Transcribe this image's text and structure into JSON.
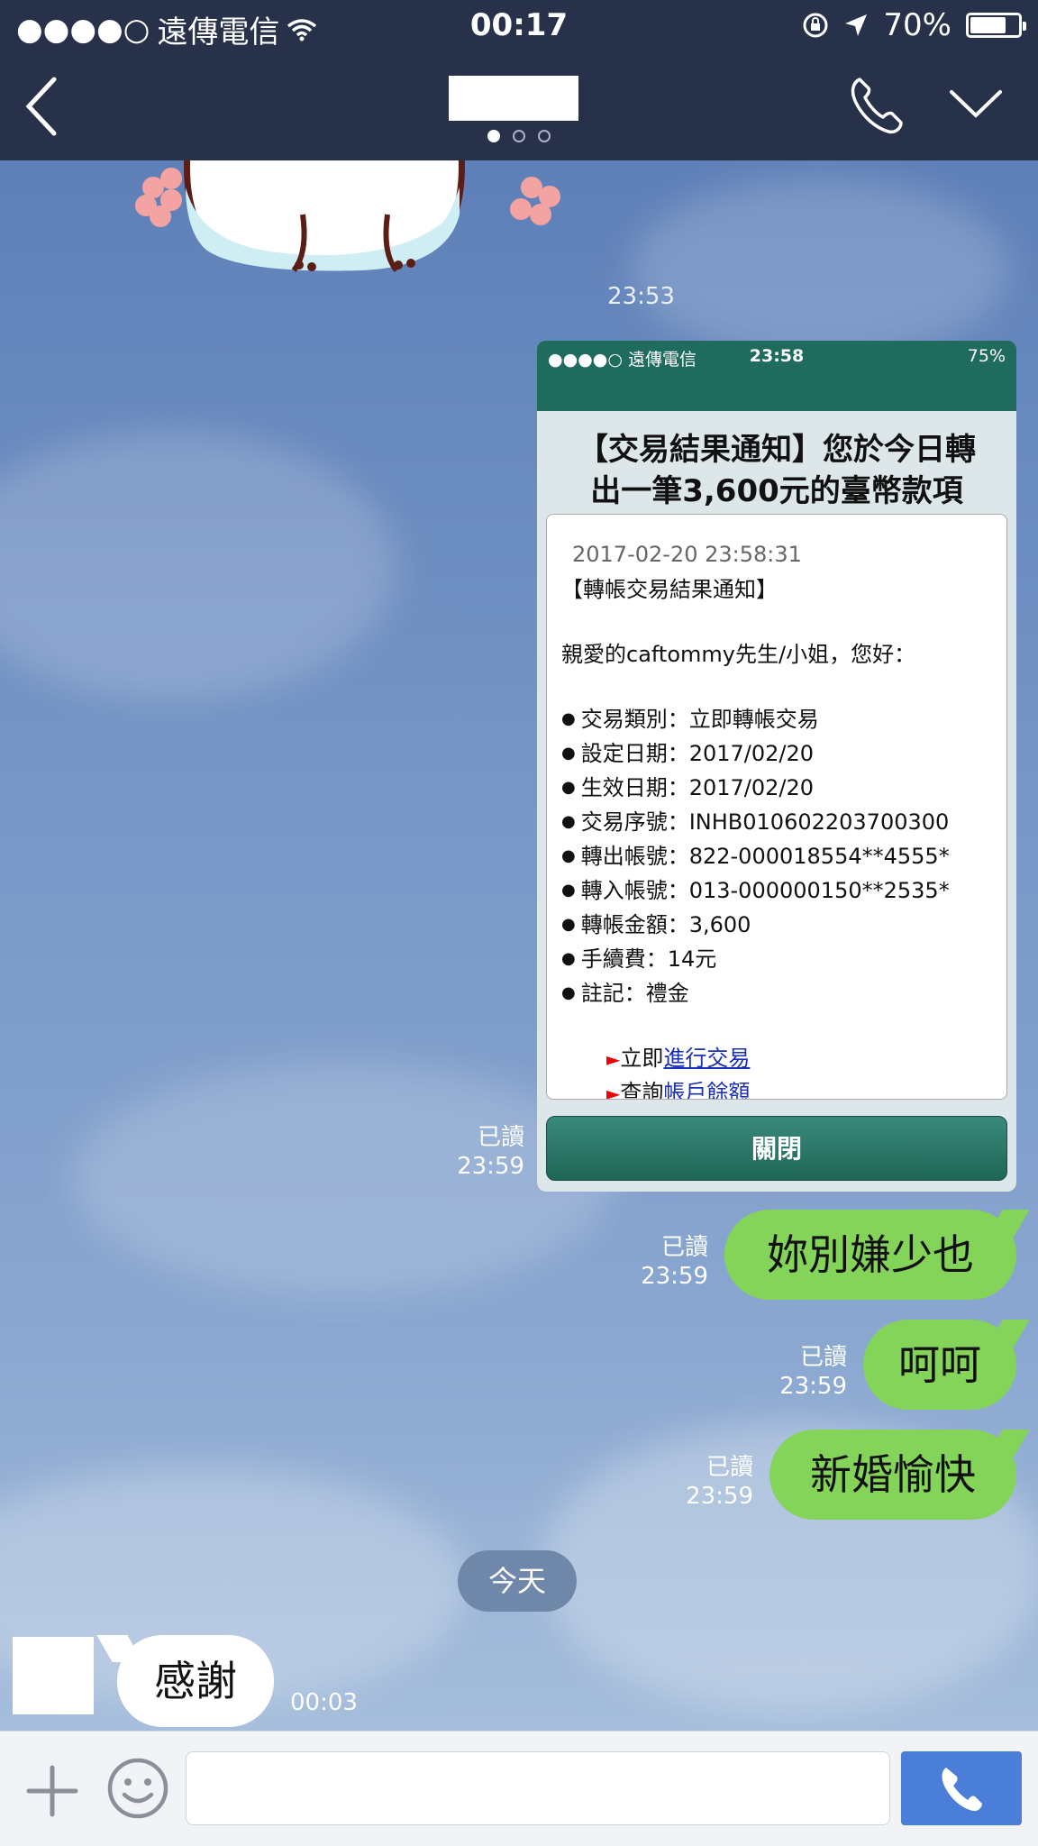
{
  "status_bar": {
    "signal": "●●●●○",
    "carrier": "遠傳電信",
    "time": "00:17",
    "battery": "70%"
  },
  "nav": {
    "page_dots": 3,
    "active_dot": 0
  },
  "messages": {
    "sticker_time": "23:53",
    "screenshot": {
      "status": {
        "signal": "●●●●○",
        "carrier": "遠傳電信",
        "time": "23:58",
        "battery": "75%"
      },
      "headline_line1": "【交易結果通知】您於今日轉",
      "headline_line2": "出一筆3,600元的臺幣款項",
      "timestamp": "2017-02-20 23:58:31",
      "notice_title": "【轉帳交易結果通知】",
      "greeting": "親愛的caftommy先生/小姐，您好：",
      "items": [
        "交易類別：立即轉帳交易",
        "設定日期：2017/02/20",
        "生效日期：2017/02/20",
        "交易序號：INHB010602203700300",
        "轉出帳號：822-000018554**4555*",
        "轉入帳號：013-000000150**2535*",
        "轉帳金額：3,600",
        "手續費：14元",
        "註記：禮金"
      ],
      "link1_prefix": "立即",
      "link1": "進行交易",
      "link2_prefix": "查詢",
      "link2": "帳戶餘額",
      "close_label": "關閉",
      "read": "已讀",
      "time": "23:59"
    },
    "out1": {
      "text": "妳別嫌少也",
      "read": "已讀",
      "time": "23:59"
    },
    "out2": {
      "text": "呵呵",
      "read": "已讀",
      "time": "23:59"
    },
    "out3": {
      "text": "新婚愉快",
      "read": "已讀",
      "time": "23:59"
    },
    "date_divider": "今天",
    "in1": {
      "text": "感謝",
      "time": "00:03"
    }
  },
  "input": {
    "placeholder": ""
  },
  "colors": {
    "bar": "#27314a",
    "bubble_out": "#84d45a",
    "send_button": "#4b7ed8"
  }
}
